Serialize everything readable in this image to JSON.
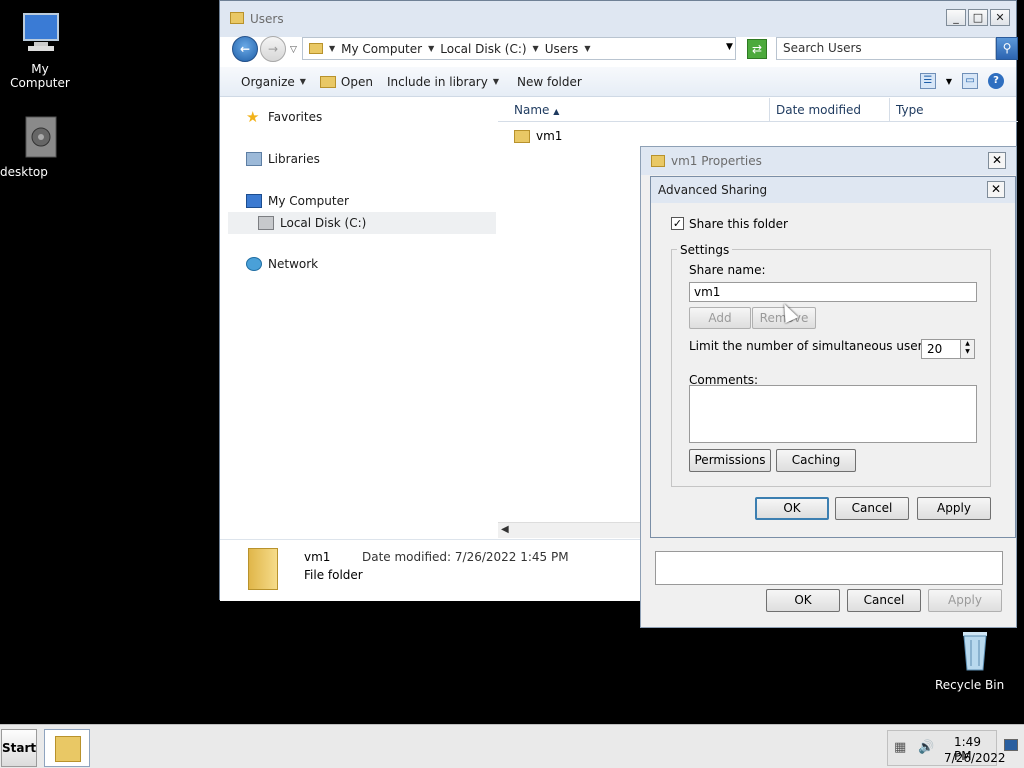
{
  "desktop": {
    "icons": [
      {
        "label": "My Computer",
        "icon": "computer-icon"
      },
      {
        "label": "desktop",
        "icon": "gear-file-icon"
      },
      {
        "label": "Recycle Bin",
        "icon": "recycle-bin-icon"
      }
    ]
  },
  "explorer": {
    "title": "Users",
    "address": {
      "crumbs": [
        "My Computer",
        "Local Disk (C:)",
        "Users"
      ]
    },
    "search_placeholder": "Search Users",
    "toolbar": {
      "organize": "Organize",
      "open": "Open",
      "include": "Include in library",
      "new_folder": "New folder"
    },
    "nav": {
      "favorites": "Favorites",
      "libraries": "Libraries",
      "computer": "My Computer",
      "local_disk": "Local Disk (C:)",
      "network": "Network"
    },
    "columns": {
      "name": "Name",
      "date_modified": "Date modified",
      "type": "Type"
    },
    "files": [
      {
        "name": "vm1"
      }
    ],
    "details": {
      "name": "vm1",
      "modified": "Date modified:  7/26/2022 1:45 PM",
      "type": "File folder"
    }
  },
  "properties": {
    "title": "vm1 Properties",
    "ok": "OK",
    "cancel": "Cancel",
    "apply": "Apply"
  },
  "advanced_sharing": {
    "title": "Advanced Sharing",
    "share_checkbox_label": "Share this folder",
    "share_checked": true,
    "settings_legend": "Settings",
    "share_name_label": "Share name:",
    "share_name_value": "vm1",
    "add": "Add",
    "remove": "Remove",
    "limit_label": "Limit the number of simultaneous users to:",
    "limit_value": "20",
    "comments_label": "Comments:",
    "comments_value": "",
    "permissions": "Permissions",
    "caching": "Caching",
    "ok": "OK",
    "cancel": "Cancel",
    "apply": "Apply"
  },
  "taskbar": {
    "start": "Start",
    "time": "1:49 PM",
    "date": "7/26/2022"
  }
}
